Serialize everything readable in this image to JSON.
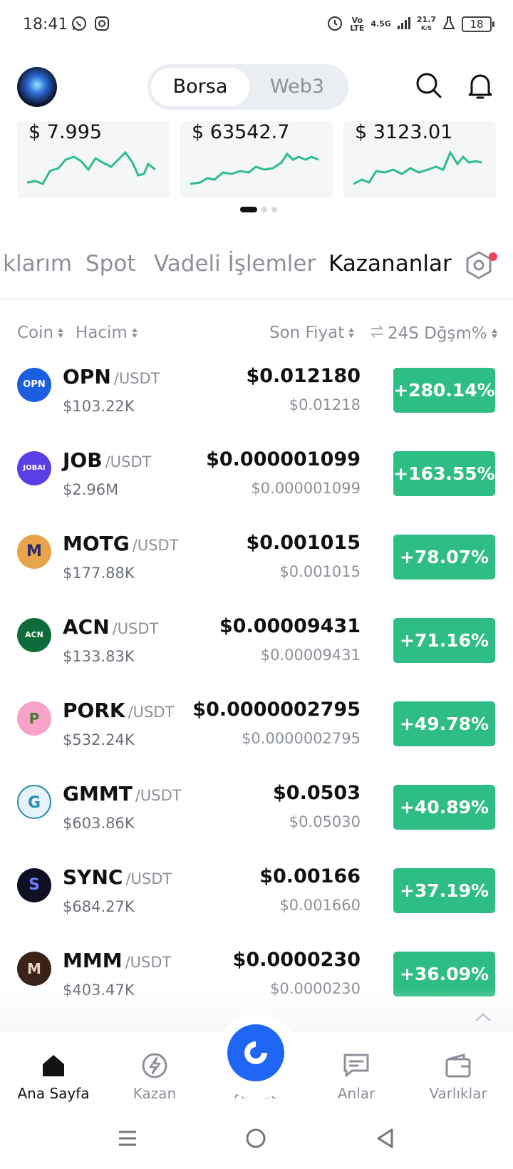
{
  "status_bar": {
    "time": "18:41",
    "network_volte": "Vo LTE",
    "network_type": "4.5G",
    "speed_value": "21.7",
    "speed_unit": "K/S",
    "battery": "18"
  },
  "header": {
    "segment_options": [
      "Borsa",
      "Web3"
    ],
    "selected_segment": "Borsa",
    "icons": [
      "search-icon",
      "bell-icon"
    ]
  },
  "mini_cards": [
    {
      "price": "$ 7.995"
    },
    {
      "price": "$ 63542.7"
    },
    {
      "price": "$ 3123.01"
    }
  ],
  "category_tabs": [
    "klarım",
    "Spot",
    "Vadeli İşlemler",
    "Kazananlar"
  ],
  "active_category": "Kazananlar",
  "table_headers": {
    "coin": "Coin",
    "volume": "Hacim",
    "last_price": "Son Fiyat",
    "change": "24S Dğşm%"
  },
  "rows": [
    {
      "symbol": "OPN",
      "quote": "/USDT",
      "volume": "$103.22K",
      "price": "$0.012180",
      "price_sub": "$0.01218",
      "change": "+280.14%",
      "logo_color": "#1b5fe0",
      "logo_text": "OPN"
    },
    {
      "symbol": "JOB",
      "quote": "/USDT",
      "volume": "$2.96M",
      "price": "$0.000001099",
      "price_sub": "$0.000001099",
      "change": "+163.55%",
      "logo_color": "#5b3fe6",
      "logo_text": "JOBAI"
    },
    {
      "symbol": "MOTG",
      "quote": "/USDT",
      "volume": "$177.88K",
      "price": "$0.001015",
      "price_sub": "$0.001015",
      "change": "+78.07%",
      "logo_color": "#e8a44a",
      "logo_text": "M"
    },
    {
      "symbol": "ACN",
      "quote": "/USDT",
      "volume": "$133.83K",
      "price": "$0.00009431",
      "price_sub": "$0.00009431",
      "change": "+71.16%",
      "logo_color": "#0f6b3a",
      "logo_text": "ACN"
    },
    {
      "symbol": "PORK",
      "quote": "/USDT",
      "volume": "$532.24K",
      "price": "$0.0000002795",
      "price_sub": "$0.0000002795",
      "change": "+49.78%",
      "logo_color": "#f6a3c7",
      "logo_text": "P"
    },
    {
      "symbol": "GMMT",
      "quote": "/USDT",
      "volume": "$603.86K",
      "price": "$0.0503",
      "price_sub": "$0.05030",
      "change": "+40.89%",
      "logo_color": "#2a8fb0",
      "logo_text": "G"
    },
    {
      "symbol": "SYNC",
      "quote": "/USDT",
      "volume": "$684.27K",
      "price": "$0.00166",
      "price_sub": "$0.001660",
      "change": "+37.19%",
      "logo_color": "#101024",
      "logo_text": "S"
    },
    {
      "symbol": "MMM",
      "quote": "/USDT",
      "volume": "$403.47K",
      "price": "$0.0000230",
      "price_sub": "$0.0000230",
      "change": "+36.09%",
      "logo_color": "#3a2418",
      "logo_text": "M"
    }
  ],
  "bottom_nav": [
    {
      "label": "Ana Sayfa",
      "icon": "home-icon"
    },
    {
      "label": "Kazan",
      "icon": "bolt-icon"
    },
    {
      "label": "Al Sat",
      "icon": "trade-icon"
    },
    {
      "label": "Anlar",
      "icon": "chat-icon"
    },
    {
      "label": "Varlıklar",
      "icon": "wallet-icon"
    }
  ],
  "colors": {
    "positive": "#2ebd85",
    "accent": "#1f66f5",
    "sparkline": "#2ebd85"
  }
}
